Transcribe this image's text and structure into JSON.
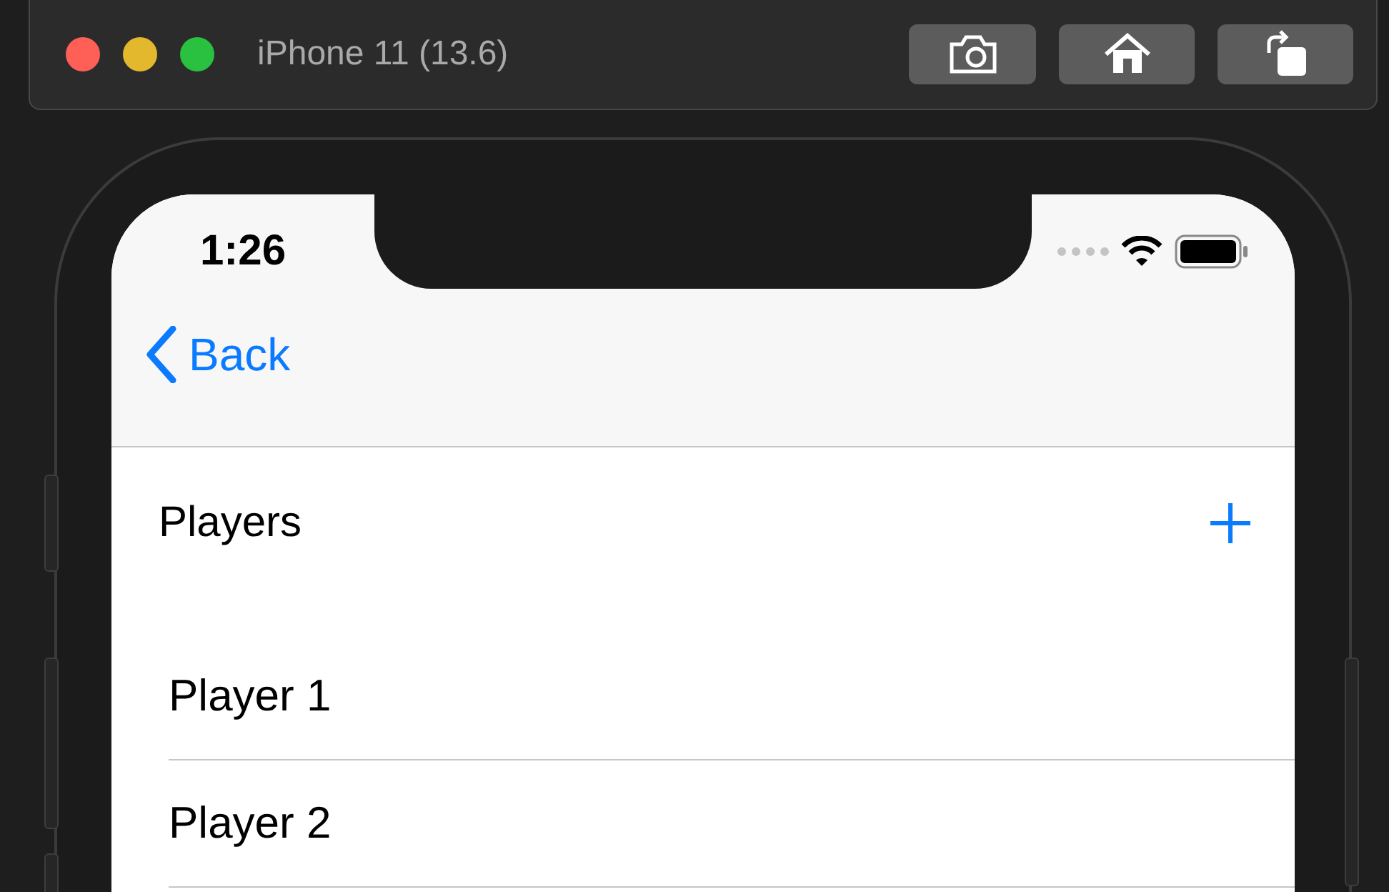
{
  "window": {
    "title": "iPhone 11 (13.6)"
  },
  "status_bar": {
    "time": "1:26"
  },
  "nav_bar": {
    "back_label": "Back"
  },
  "section": {
    "title": "Players"
  },
  "players": [
    {
      "name": "Player 1"
    },
    {
      "name": "Player 2"
    }
  ]
}
